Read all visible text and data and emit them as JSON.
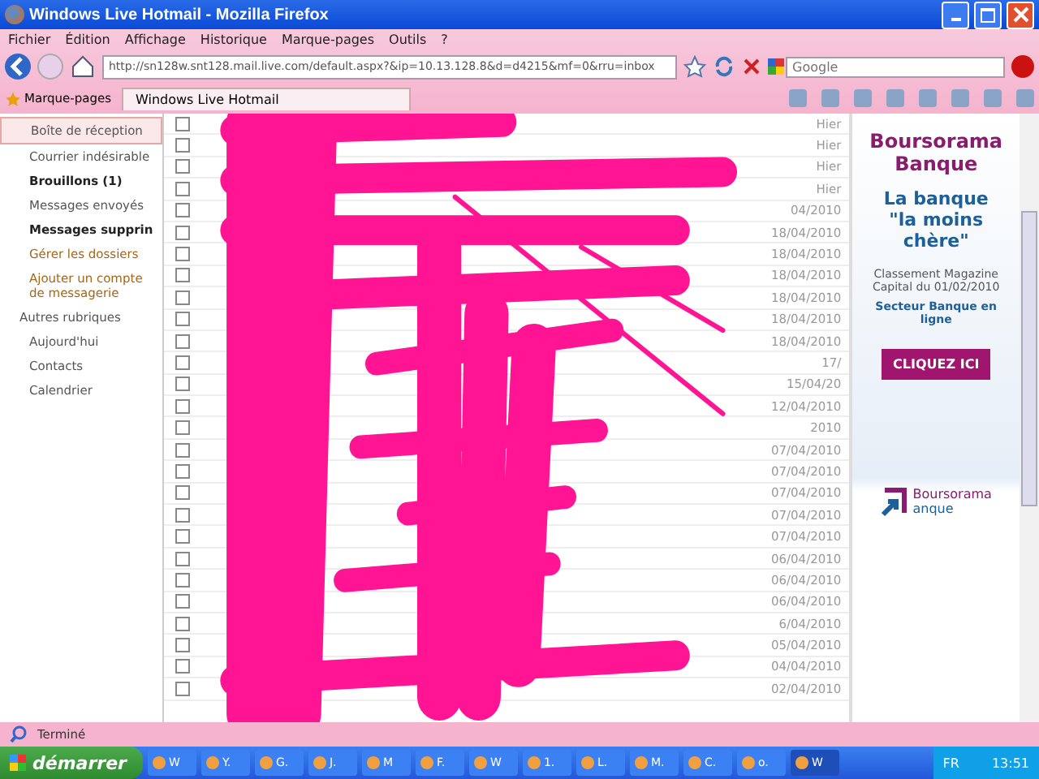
{
  "window": {
    "title": "Windows Live Hotmail - Mozilla Firefox"
  },
  "menu": [
    "Fichier",
    "Édition",
    "Affichage",
    "Historique",
    "Marque-pages",
    "Outils",
    "?"
  ],
  "navigation": {
    "url": "http://sn128w.snt128.mail.live.com/default.aspx?&ip=10.13.128.8&d=d4215&mf=0&rru=inbox",
    "search_placeholder": "Google"
  },
  "bookmarks": {
    "label": "Marque-pages",
    "tabs": [
      {
        "label": "Windows Live Hotmail",
        "selected": true
      }
    ]
  },
  "sidebar": {
    "items": [
      {
        "label": "Boîte de réception",
        "kind": "folder",
        "selected": true
      },
      {
        "label": "Courrier indésirable",
        "kind": "folder",
        "selected": false
      },
      {
        "label": "Brouillons (1)",
        "kind": "unread",
        "selected": false
      },
      {
        "label": "Messages envoyés",
        "kind": "folder",
        "selected": false
      },
      {
        "label": "Messages supprin",
        "kind": "unread",
        "selected": false
      },
      {
        "label": "Gérer les dossiers",
        "kind": "action",
        "selected": false
      },
      {
        "label": "Ajouter un compte de messagerie",
        "kind": "action",
        "selected": false
      },
      {
        "label": "Autres rubriques",
        "kind": "heading",
        "selected": false
      },
      {
        "label": "Aujourd'hui",
        "kind": "folder",
        "selected": false
      },
      {
        "label": "Contacts",
        "kind": "folder",
        "selected": false
      },
      {
        "label": "Calendrier",
        "kind": "folder",
        "selected": false
      }
    ]
  },
  "messages": [
    {
      "date": "Hier",
      "checked": false
    },
    {
      "date": "Hier",
      "checked": false
    },
    {
      "date": "Hier",
      "checked": false
    },
    {
      "date": "Hier",
      "checked": false
    },
    {
      "date": "04/2010",
      "checked": false
    },
    {
      "date": "18/04/2010",
      "checked": false
    },
    {
      "date": "18/04/2010",
      "checked": false
    },
    {
      "date": "18/04/2010",
      "checked": false
    },
    {
      "date": "18/04/2010",
      "checked": false
    },
    {
      "date": "18/04/2010",
      "checked": false
    },
    {
      "date": "18/04/2010",
      "checked": false
    },
    {
      "date": "17/",
      "checked": false
    },
    {
      "date": "15/04/20",
      "checked": false
    },
    {
      "date": "12/04/2010",
      "checked": false
    },
    {
      "date": "2010",
      "checked": false
    },
    {
      "date": "07/04/2010",
      "checked": false
    },
    {
      "date": "07/04/2010",
      "checked": false
    },
    {
      "date": "07/04/2010",
      "checked": false
    },
    {
      "date": "07/04/2010",
      "checked": false
    },
    {
      "date": "07/04/2010",
      "checked": false
    },
    {
      "date": "06/04/2010",
      "checked": false
    },
    {
      "date": "06/04/2010",
      "checked": false
    },
    {
      "date": "06/04/2010",
      "checked": false
    },
    {
      "date": "6/04/2010",
      "checked": false
    },
    {
      "date": "05/04/2010",
      "checked": false
    },
    {
      "date": "04/04/2010",
      "checked": false
    },
    {
      "date": "02/04/2010",
      "checked": false
    }
  ],
  "ad": {
    "title": "Boursorama Banque",
    "headline": "La banque \"la moins chère\"",
    "ranking": "Classement Magazine Capital du 01/02/2010",
    "sector": "Secteur Banque en ligne",
    "button": "CLIQUEZ ICI",
    "logo_top": "Boursorama",
    "logo_bottom": "anque"
  },
  "status_bar": {
    "text": "Terminé"
  },
  "taskbar": {
    "start": "démarrer",
    "items": [
      "W",
      "Y.",
      "G.",
      "J.",
      "M",
      "F.",
      "W",
      "1.",
      "L.",
      "M.",
      "C.",
      "o.",
      "W"
    ],
    "language": "FR",
    "clock": "13:51"
  }
}
